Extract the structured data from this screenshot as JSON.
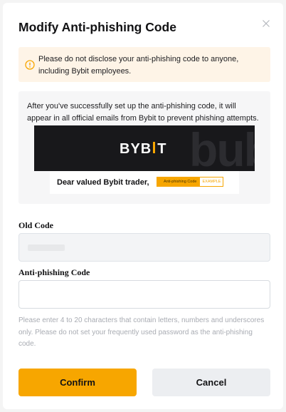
{
  "dialog": {
    "title": "Modify Anti-phishing Code",
    "warning": "Please do not disclose your anti-phishing code to anyone, including Bybit employees.",
    "description": "After you've successfully set up the anti-phishing code, it will appear in all official emails from Bybit to prevent phishing attempts."
  },
  "preview": {
    "logo_left": "BYB",
    "logo_right": "T",
    "watermark": "bub",
    "greeting": "Dear valued Bybit trader,",
    "tag_label": "Anti-phishing Code",
    "tag_value": "EXAMPLE"
  },
  "form": {
    "old_code_label": "Old Code",
    "old_code_value": "",
    "anti_code_label": "Anti-phishing Code",
    "anti_code_value": "",
    "hint": "Please enter 4 to 20 characters that contain letters, numbers and underscores only. Please do not set your frequently used password as the anti-phishing code."
  },
  "buttons": {
    "confirm": "Confirm",
    "cancel": "Cancel"
  },
  "icons": {
    "close": "close-icon",
    "warning": "warning-icon"
  },
  "colors": {
    "accent": "#f7a600",
    "warning_bg": "#fef4e7",
    "hint_text": "#a9acb3"
  }
}
